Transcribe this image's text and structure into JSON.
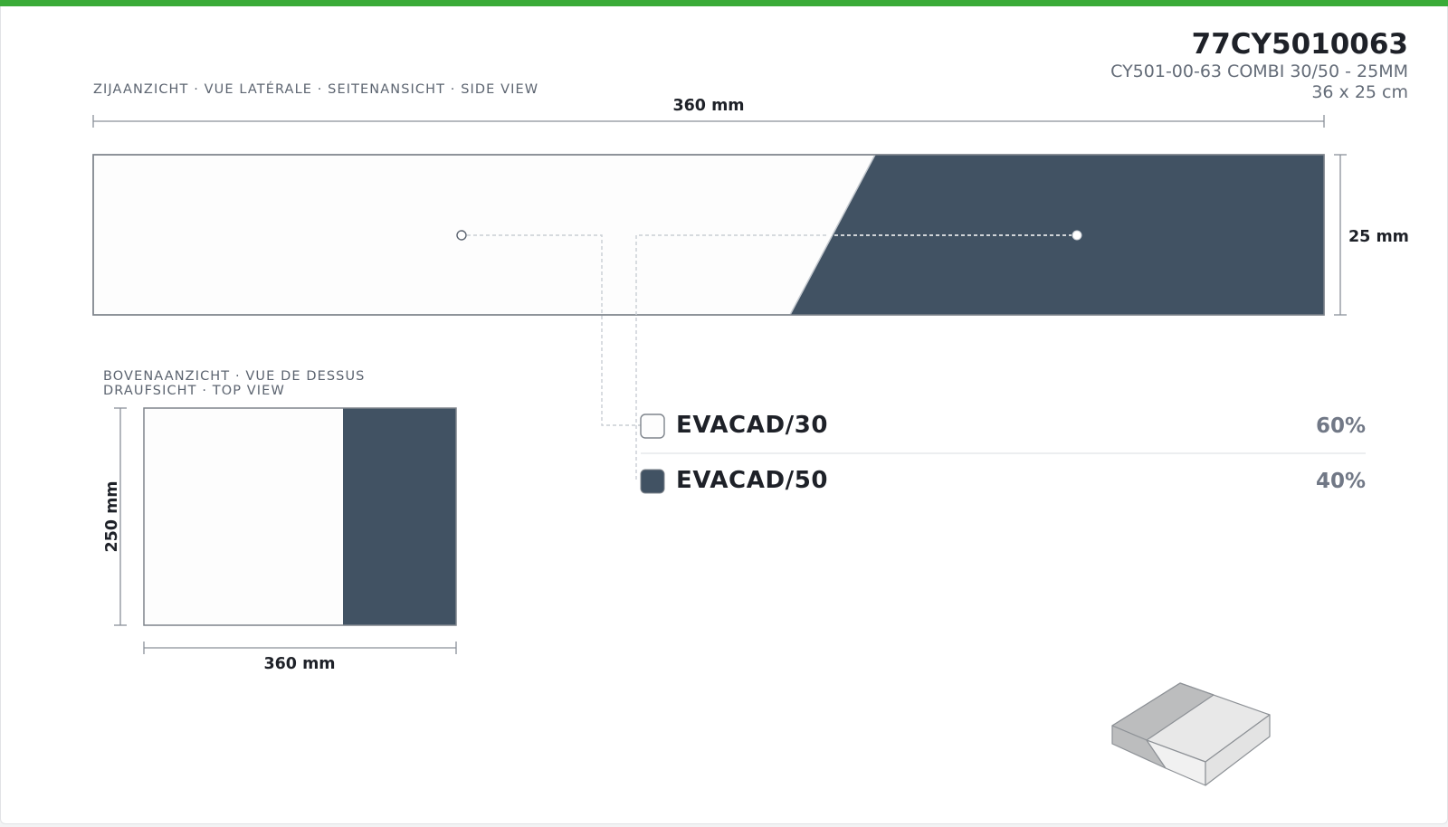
{
  "product": {
    "code": "77CY5010063",
    "description": "CY501-00-63 COMBI 30/50 - 25MM",
    "size": "36 x 25 cm"
  },
  "side_view": {
    "caption": "ZIJAANZICHT · VUE LATÉRALE · SEITENANSICHT · SIDE VIEW",
    "width_label": "360 mm",
    "height_label": "25 mm"
  },
  "top_view": {
    "caption_line1": "BOVENAANZICHT · VUE DE DESSUS",
    "caption_line2": "DRAUFSICHT · TOP VIEW",
    "height_label": "250 mm",
    "width_label": "360 mm"
  },
  "materials": [
    {
      "name": "EVACAD/30",
      "percent": "60%",
      "color": "#fdfdfd"
    },
    {
      "name": "EVACAD/50",
      "percent": "40%",
      "color": "#415263"
    }
  ],
  "colors": {
    "accent_bar": "#3aab38",
    "dark_material": "#415263",
    "light_material": "#fdfdfd",
    "outline": "#7e848c"
  },
  "icons": {
    "isometric_preview": "block-3d-icon"
  }
}
